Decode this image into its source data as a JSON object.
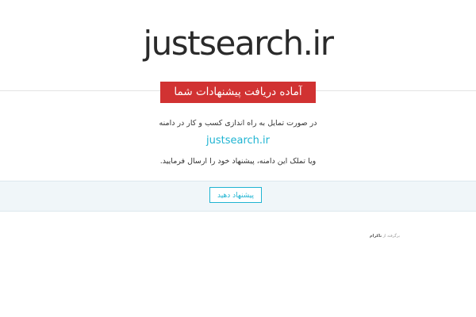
{
  "header": {
    "site_title": "justsearch.ir"
  },
  "banner": {
    "text": "آماده دریافت پیشنهادات شما"
  },
  "content": {
    "line1": "در صورت تمایل به راه اندازی کسب و کار در دامنه",
    "domain": "justsearch.ir",
    "line3": "ویا تملک این دامنه، پیشنهاد خود را ارسال فرمایید."
  },
  "offer": {
    "button_label": "پیشنهاد دهید"
  },
  "footer": {
    "credit_prefix": "برگرفته از",
    "credit_brand": "ناکرام"
  },
  "colors": {
    "banner_bg": "#d13232",
    "accent": "#1fb4d2",
    "band_bg": "#f0f6f9"
  }
}
